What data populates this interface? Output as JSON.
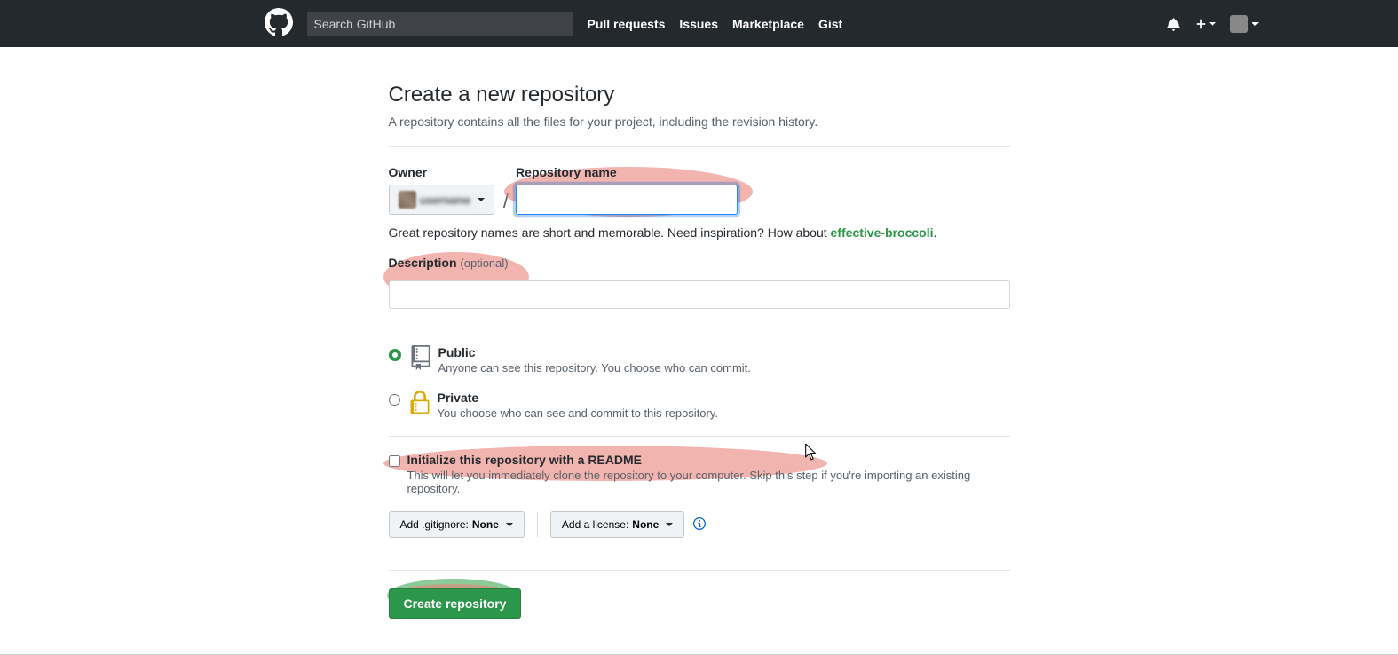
{
  "header": {
    "search_placeholder": "Search GitHub",
    "nav": {
      "pull_requests": "Pull requests",
      "issues": "Issues",
      "marketplace": "Marketplace",
      "gist": "Gist"
    }
  },
  "page": {
    "title": "Create a new repository",
    "subtitle": "A repository contains all the files for your project, including the revision history."
  },
  "form": {
    "owner_label": "Owner",
    "owner_name": "username",
    "repo_name_label": "Repository name",
    "repo_name_value": "",
    "hint_prefix": "Great repository names are short and memorable. Need inspiration? How about ",
    "suggestion": "effective-broccoli",
    "hint_suffix": ".",
    "description_label": "Description",
    "description_optional": "(optional)",
    "description_value": "",
    "visibility": {
      "public": {
        "title": "Public",
        "desc": "Anyone can see this repository. You choose who can commit."
      },
      "private": {
        "title": "Private",
        "desc": "You choose who can see and commit to this repository."
      },
      "selected": "public"
    },
    "init": {
      "title": "Initialize this repository with a README",
      "desc": "This will let you immediately clone the repository to your computer. Skip this step if you're importing an existing repository.",
      "checked": false
    },
    "gitignore": {
      "prefix": "Add .gitignore: ",
      "value": "None"
    },
    "license": {
      "prefix": "Add a license: ",
      "value": "None"
    },
    "submit_label": "Create repository"
  }
}
